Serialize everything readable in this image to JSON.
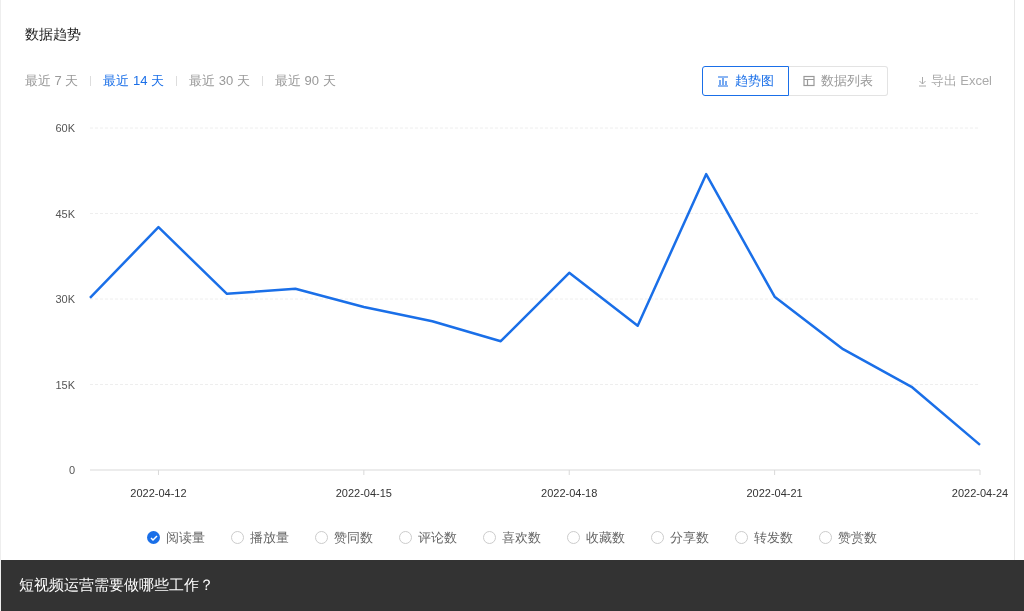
{
  "title": "数据趋势",
  "ranges": [
    {
      "label": "最近 7 天",
      "selected": false
    },
    {
      "label": "最近 14 天",
      "selected": true
    },
    {
      "label": "最近 30 天",
      "selected": false
    },
    {
      "label": "最近 90 天",
      "selected": false
    }
  ],
  "views": [
    {
      "label": "趋势图",
      "selected": true,
      "kind": "chart"
    },
    {
      "label": "数据列表",
      "selected": false,
      "kind": "list"
    }
  ],
  "export": {
    "label": "导出 Excel"
  },
  "chart_data": {
    "type": "line",
    "grid": true,
    "categories": [
      null,
      "2022-04-12",
      null,
      null,
      "2022-04-15",
      null,
      null,
      "2022-04-18",
      null,
      null,
      "2022-04-21",
      null,
      null,
      "2022-04-24"
    ],
    "series": [
      {
        "color": "#1a6fe8",
        "values": [
          30200,
          42600,
          30900,
          31800,
          28600,
          26100,
          22600,
          34600,
          25300,
          51900,
          30400,
          21200,
          14600,
          4400
        ]
      }
    ],
    "ylim": [
      0,
      60000
    ],
    "yticks": [
      {
        "value": 0,
        "label": "0"
      },
      {
        "value": 15000,
        "label": "15K"
      },
      {
        "value": 30000,
        "label": "30K"
      },
      {
        "value": 45000,
        "label": "45K"
      },
      {
        "value": 60000,
        "label": "60K"
      }
    ]
  },
  "legend": [
    {
      "label": "阅读量",
      "selected": true
    },
    {
      "label": "播放量",
      "selected": false
    },
    {
      "label": "赞同数",
      "selected": false
    },
    {
      "label": "评论数",
      "selected": false
    },
    {
      "label": "喜欢数",
      "selected": false
    },
    {
      "label": "收藏数",
      "selected": false
    },
    {
      "label": "分享数",
      "selected": false
    },
    {
      "label": "转发数",
      "selected": false
    },
    {
      "label": "赞赏数",
      "selected": false
    }
  ],
  "caption": "短视频运营需要做哪些工作？"
}
